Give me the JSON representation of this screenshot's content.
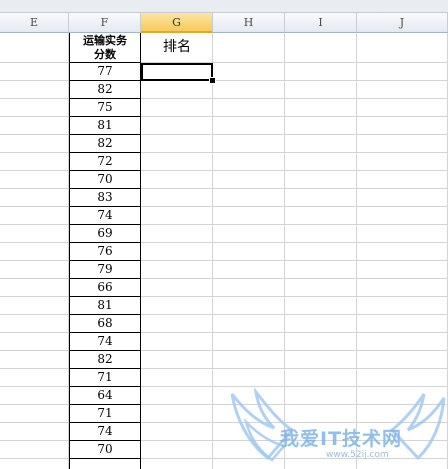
{
  "columns": [
    {
      "letter": "E",
      "active": false
    },
    {
      "letter": "F",
      "active": false
    },
    {
      "letter": "G",
      "active": true
    },
    {
      "letter": "H",
      "active": false
    },
    {
      "letter": "I",
      "active": false
    },
    {
      "letter": "J",
      "active": false
    }
  ],
  "header_F": [
    "运输实务",
    "分数"
  ],
  "header_G": "排名",
  "scores": [
    "77",
    "82",
    "75",
    "81",
    "82",
    "72",
    "70",
    "83",
    "74",
    "69",
    "76",
    "79",
    "66",
    "81",
    "68",
    "74",
    "82",
    "71",
    "64",
    "71",
    "74",
    "70"
  ],
  "watermark": {
    "text": "我爱IT技术网",
    "url": "www.52ij.com"
  },
  "colors": {
    "active_header": "#f6c95d",
    "gridline": "#d4d4d4",
    "watermark": "#7fb4e6"
  }
}
